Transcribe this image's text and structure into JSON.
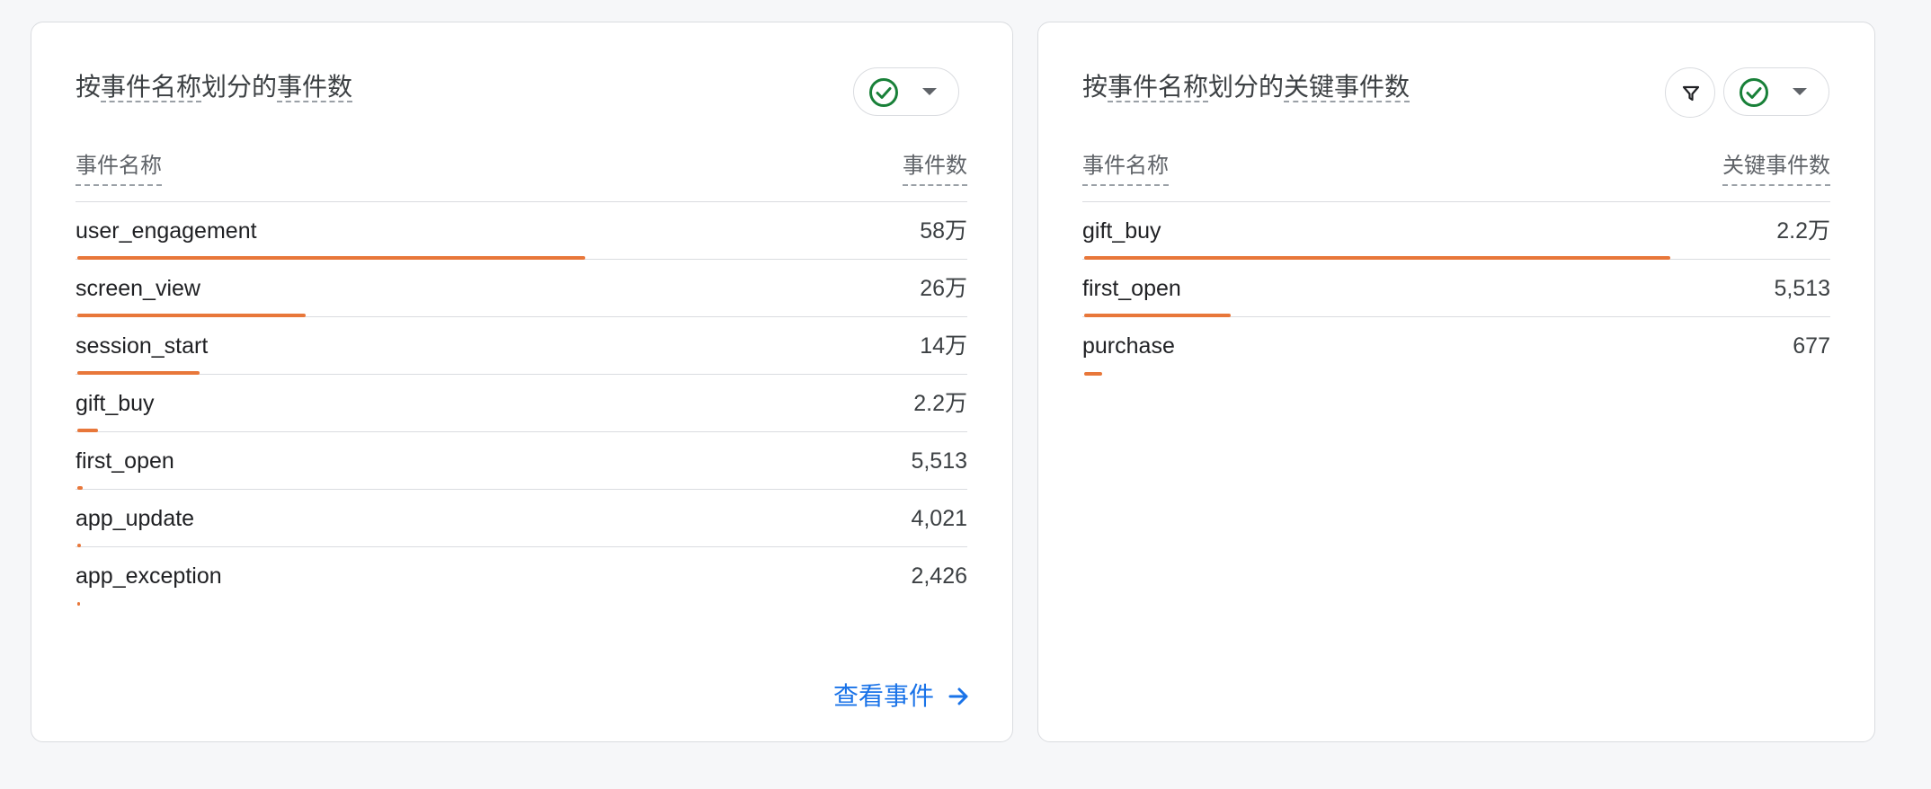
{
  "left_card": {
    "title_prefix": "按",
    "title_dim1": "事件名称",
    "title_mid": "划分的",
    "title_metric": "事件数",
    "col_name": "事件名称",
    "col_value": "事件数",
    "rows": [
      {
        "name": "user_engagement",
        "value": "58万",
        "ratio": 1.0
      },
      {
        "name": "screen_view",
        "value": "26万",
        "ratio": 0.45
      },
      {
        "name": "session_start",
        "value": "14万",
        "ratio": 0.24
      },
      {
        "name": "gift_buy",
        "value": "2.2万",
        "ratio": 0.04
      },
      {
        "name": "first_open",
        "value": "5,513",
        "ratio": 0.01
      },
      {
        "name": "app_update",
        "value": "4,021",
        "ratio": 0.007
      },
      {
        "name": "app_exception",
        "value": "2,426",
        "ratio": 0.004
      }
    ],
    "view_link": "查看事件",
    "check_icon": "check-circle-icon",
    "caret_icon": "caret-down-icon"
  },
  "right_card": {
    "title_prefix": "按",
    "title_dim1": "事件名称",
    "title_mid": "划分的",
    "title_metric": "关键事件数",
    "col_name": "事件名称",
    "col_value": "关键事件数",
    "rows": [
      {
        "name": "gift_buy",
        "value": "2.2万",
        "ratio": 1.0
      },
      {
        "name": "first_open",
        "value": "5,513",
        "ratio": 0.25
      },
      {
        "name": "purchase",
        "value": "677",
        "ratio": 0.031
      }
    ],
    "filter_icon": "filter-icon",
    "check_icon": "check-circle-icon",
    "caret_icon": "caret-down-icon"
  },
  "colors": {
    "bar": "#e8773a",
    "link": "#1a73e8",
    "check": "#188038"
  }
}
